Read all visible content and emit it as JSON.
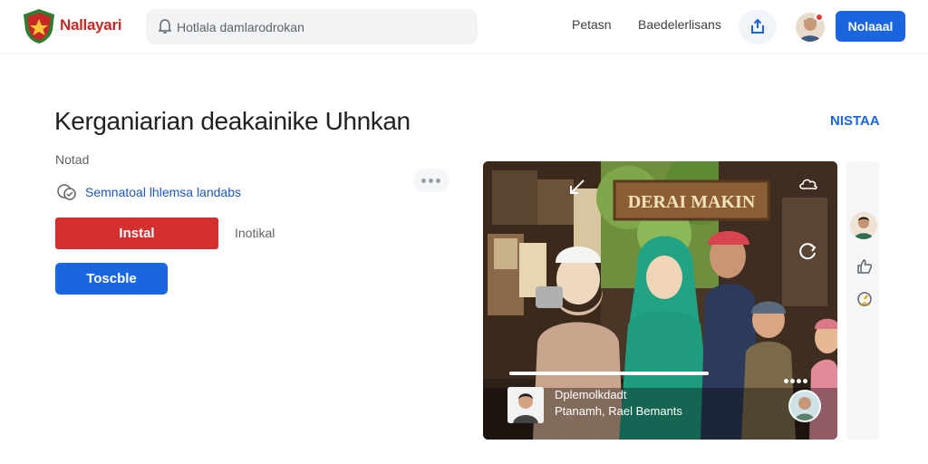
{
  "header": {
    "brand": "Nallayari",
    "search_placeholder": "Hotlala damlarodrokan",
    "nav": [
      "Petasn",
      "Baedelerlisans"
    ],
    "primary_button": "Nolaaal"
  },
  "main": {
    "title": "Kerganiarian deakainike Uhnkan",
    "title_link": "NISTAA",
    "meta": "Notad",
    "feature_text": "Semnatoal lhlemsa landabs",
    "install_button": "Instal",
    "install_note": "Inotikal",
    "secondary_button": "Toscble"
  },
  "media": {
    "sign_text": "DERAI MAKIN",
    "caption_title": "Dplemolkdadt",
    "caption_subtitle": "Ptanamh, Rael Bemants",
    "progress": 0.6
  },
  "colors": {
    "brand_red": "#c62828",
    "install_red": "#d32f2f",
    "accent_blue": "#1a66e0"
  }
}
